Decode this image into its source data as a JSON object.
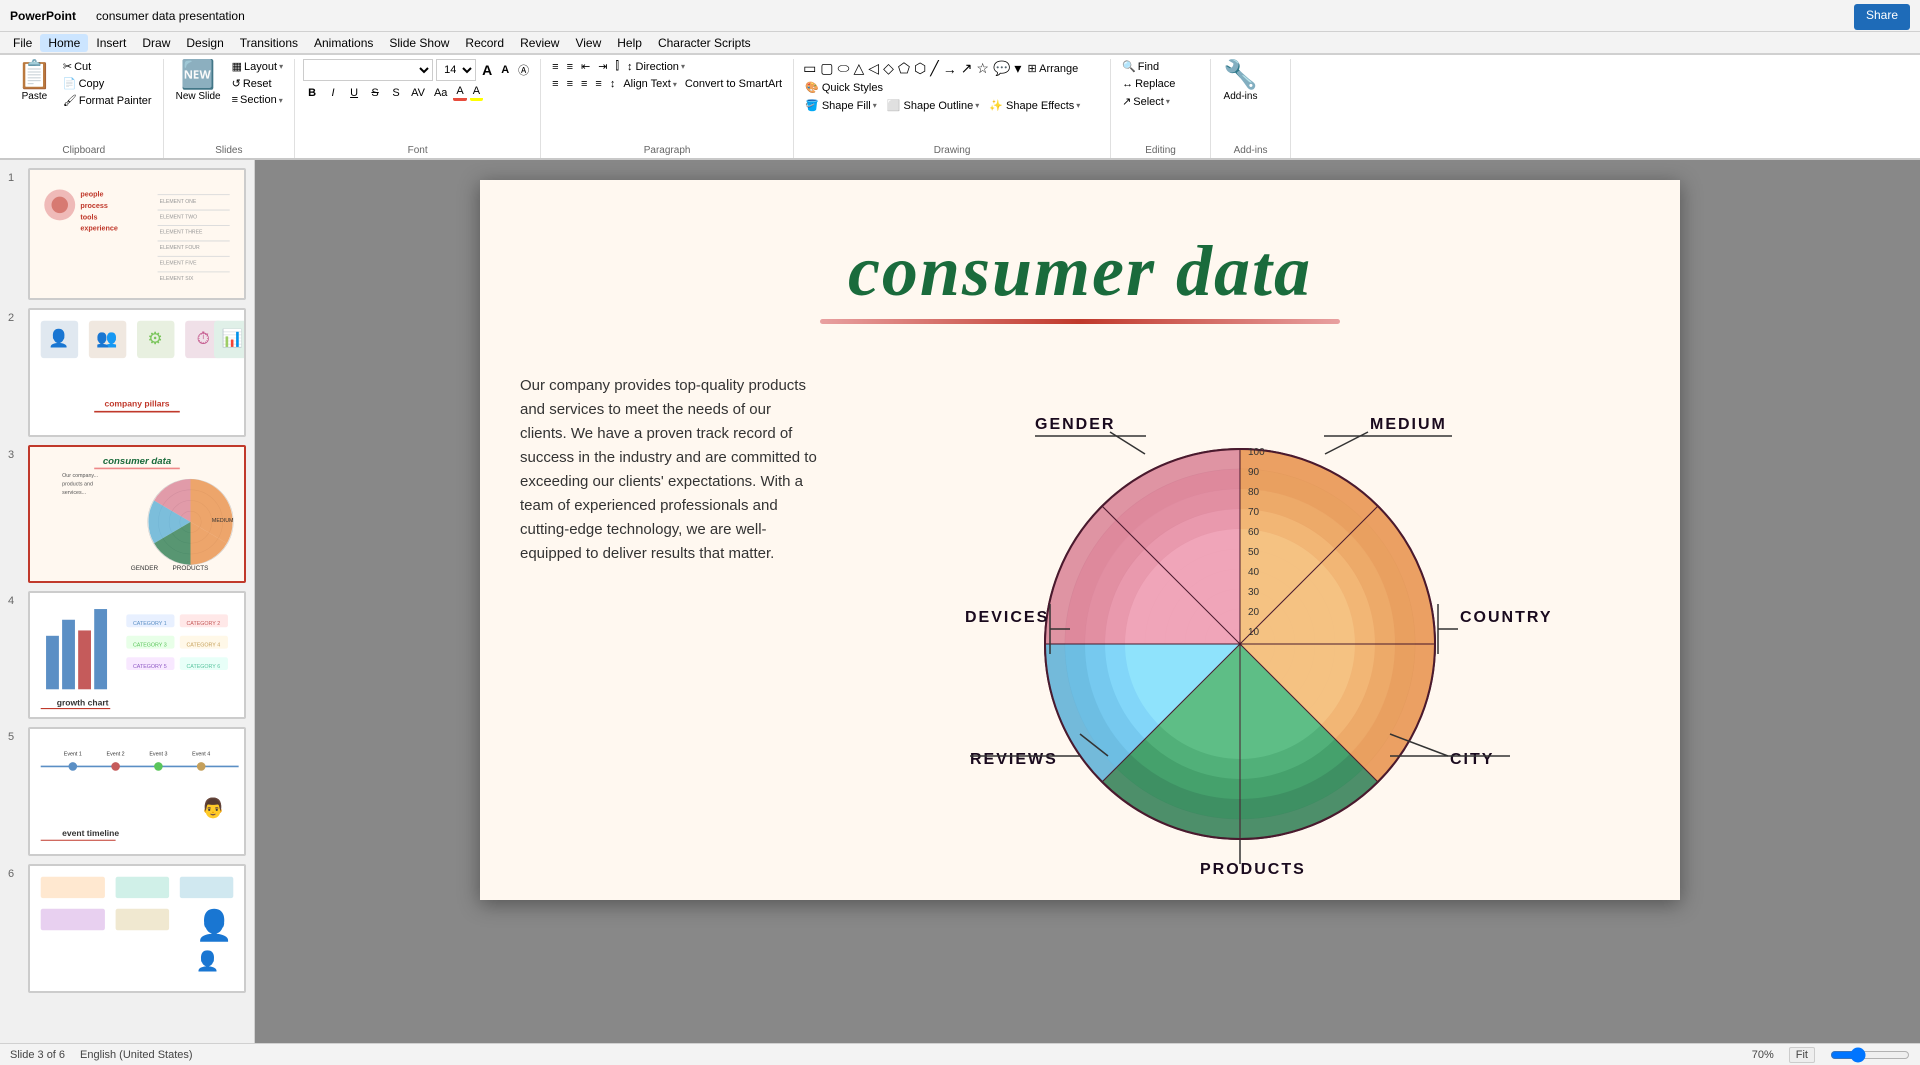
{
  "app": {
    "title": "PowerPoint - consumer data presentation",
    "share_label": "Share"
  },
  "menu": {
    "items": [
      "File",
      "Home",
      "Insert",
      "Draw",
      "Design",
      "Transitions",
      "Animations",
      "Slide Show",
      "Record",
      "Review",
      "View",
      "Help",
      "Character Scripts"
    ]
  },
  "ribbon": {
    "active_tab": "Home",
    "groups": {
      "clipboard": {
        "label": "Clipboard",
        "paste": "Paste",
        "cut": "Cut",
        "copy": "Copy",
        "format_painter": "Format Painter"
      },
      "slides": {
        "label": "Slides",
        "new_slide": "New Slide",
        "layout": "Layout",
        "reset": "Reset",
        "section": "Section"
      },
      "font": {
        "label": "Font",
        "font_name": "",
        "font_size": "14",
        "grow": "A",
        "shrink": "A",
        "clear": "A",
        "bold": "B",
        "italic": "I",
        "underline": "U",
        "strikethrough": "S",
        "shadow": "S",
        "char_spacing": "A",
        "change_case": "Aa",
        "font_color": "A",
        "highlight": "A"
      },
      "paragraph": {
        "label": "Paragraph",
        "bullets": "≡",
        "numbering": "≡",
        "decrease": "←",
        "increase": "→",
        "columns": "≡",
        "direction": "Direction",
        "align_text": "Align Text",
        "convert_smartart": "Convert to SmartArt",
        "align_left": "≡",
        "align_center": "≡",
        "align_right": "≡",
        "justify": "≡",
        "line_spacing": "≡"
      },
      "drawing": {
        "label": "Drawing",
        "arrange": "Arrange",
        "quick_styles": "Quick Styles",
        "shape_fill": "Shape Fill",
        "shape_outline": "Shape Outline",
        "shape_effects": "Shape Effects"
      },
      "editing": {
        "label": "Editing",
        "find": "Find",
        "replace": "Replace",
        "select": "Select"
      },
      "addins": {
        "label": "Add-ins",
        "addins": "Add-ins"
      }
    }
  },
  "slides": [
    {
      "num": "1",
      "type": "s1",
      "label": "",
      "active": false,
      "thumb_text": "people\nprocess\ntools\nexperience"
    },
    {
      "num": "2",
      "type": "s2",
      "label": "company pillars",
      "active": false,
      "thumb_text": "company pillars"
    },
    {
      "num": "3",
      "type": "s3",
      "label": "consumer data",
      "active": true,
      "thumb_text": "consumer data"
    },
    {
      "num": "4",
      "type": "s4",
      "label": "growth chart",
      "active": false,
      "thumb_text": "growth chart"
    },
    {
      "num": "5",
      "type": "s5",
      "label": "event timeline",
      "active": false,
      "thumb_text": "event timeline"
    },
    {
      "num": "6",
      "type": "s6",
      "label": "",
      "active": false,
      "thumb_text": ""
    }
  ],
  "slide": {
    "title": "consumer data",
    "body_text": "Our company provides top-quality products and services to meet the needs of our clients. We have a proven track record of success in the industry and are committed to exceeding our clients' expectations. With a team of experienced professionals and cutting-edge technology, we are well-equipped to deliver results that matter.",
    "chart": {
      "labels": [
        "GENDER",
        "MEDIUM",
        "COUNTRY",
        "CITY",
        "PRODUCTS",
        "REVIEWS",
        "DEVICES"
      ],
      "rings": [
        100,
        90,
        80,
        70,
        60,
        50,
        40,
        30,
        20,
        10
      ],
      "segments": {
        "orange_top": "orange",
        "orange_right": "orange",
        "blue": "#5bafd6",
        "green": "#2e7d52",
        "pink": "#d4738a"
      }
    }
  },
  "status_bar": {
    "slide_info": "Slide 3 of 6",
    "language": "English (United States)",
    "zoom": "70%",
    "fit_button": "Fit"
  },
  "icons": {
    "paste": "📋",
    "cut": "✂",
    "copy": "📄",
    "format_painter": "🖌",
    "new_slide": "🆕",
    "layout": "▦",
    "bold": "B",
    "italic": "I",
    "underline": "U",
    "search": "🔍",
    "replace": "↔",
    "select": "↗",
    "arrange": "⊞",
    "shape_fill": "🎨",
    "addins": "🔧"
  }
}
